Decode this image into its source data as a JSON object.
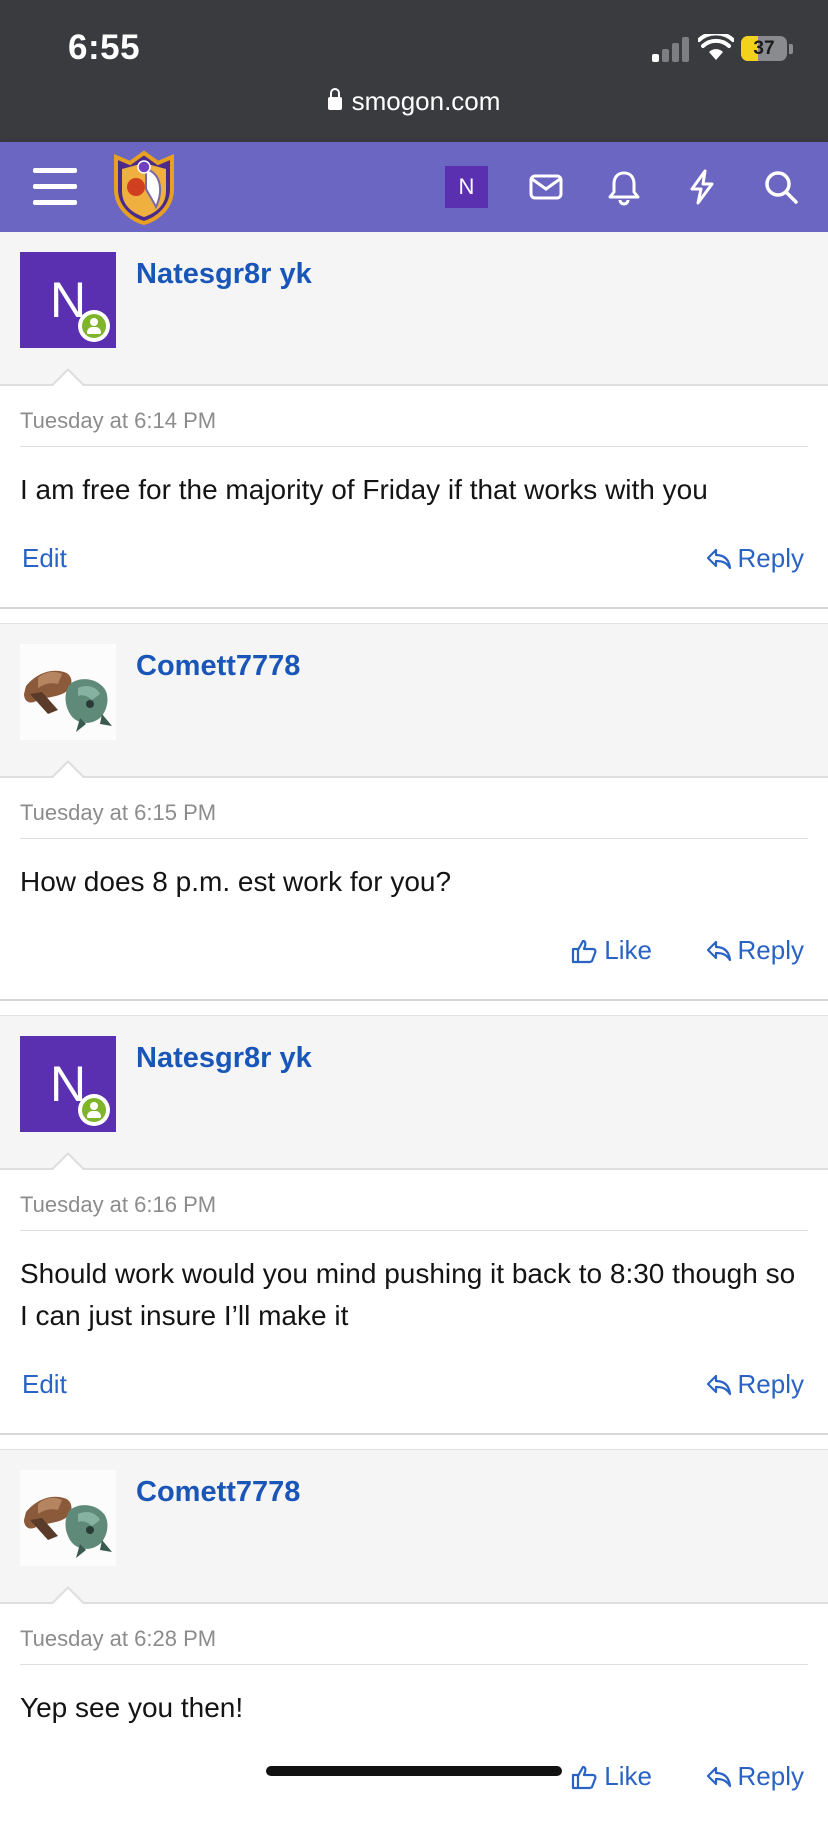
{
  "status_bar": {
    "time": "6:55",
    "battery": "37",
    "battery_level": 0.37,
    "url": "smogon.com"
  },
  "navbar": {
    "user_initial": "N",
    "icons": [
      "menu-icon",
      "site-logo",
      "envelope-icon",
      "bell-icon",
      "bolt-icon",
      "search-icon"
    ]
  },
  "colors": {
    "navbar": "#6b66c2",
    "user_avatar": "#5a2fb0",
    "link": "#2a63c4",
    "username": "#1a56b8",
    "online": "#7fb42c",
    "battery": "#f2d21b"
  },
  "posts": [
    {
      "username": "Natesgr8r yk",
      "avatar_initial": "N",
      "timestamp": "Tuesday at 6:14 PM",
      "message": "I am free for the majority of Friday if that works with you",
      "edit_label": "Edit",
      "reply_label": "Reply"
    },
    {
      "username": "Comett7778",
      "timestamp": "Tuesday at 6:15 PM",
      "message": "How does 8 p.m. est work for you?",
      "like_label": "Like",
      "reply_label": "Reply"
    },
    {
      "username": "Natesgr8r yk",
      "avatar_initial": "N",
      "timestamp": "Tuesday at 6:16 PM",
      "message": "Should work would you mind pushing it back to 8:30 though so I can just insure I’ll make it",
      "edit_label": "Edit",
      "reply_label": "Reply"
    },
    {
      "username": "Comett7778",
      "timestamp": "Tuesday at 6:28 PM",
      "message": "Yep see you then!",
      "like_label": "Like",
      "reply_label": "Reply"
    }
  ]
}
